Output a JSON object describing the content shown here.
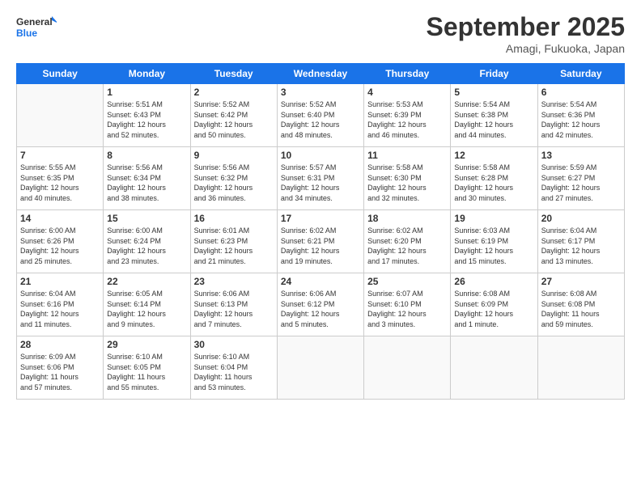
{
  "header": {
    "logo_line1": "General",
    "logo_line2": "Blue",
    "month": "September 2025",
    "location": "Amagi, Fukuoka, Japan"
  },
  "days_of_week": [
    "Sunday",
    "Monday",
    "Tuesday",
    "Wednesday",
    "Thursday",
    "Friday",
    "Saturday"
  ],
  "weeks": [
    [
      {
        "day": "",
        "text": ""
      },
      {
        "day": "1",
        "text": "Sunrise: 5:51 AM\nSunset: 6:43 PM\nDaylight: 12 hours\nand 52 minutes."
      },
      {
        "day": "2",
        "text": "Sunrise: 5:52 AM\nSunset: 6:42 PM\nDaylight: 12 hours\nand 50 minutes."
      },
      {
        "day": "3",
        "text": "Sunrise: 5:52 AM\nSunset: 6:40 PM\nDaylight: 12 hours\nand 48 minutes."
      },
      {
        "day": "4",
        "text": "Sunrise: 5:53 AM\nSunset: 6:39 PM\nDaylight: 12 hours\nand 46 minutes."
      },
      {
        "day": "5",
        "text": "Sunrise: 5:54 AM\nSunset: 6:38 PM\nDaylight: 12 hours\nand 44 minutes."
      },
      {
        "day": "6",
        "text": "Sunrise: 5:54 AM\nSunset: 6:36 PM\nDaylight: 12 hours\nand 42 minutes."
      }
    ],
    [
      {
        "day": "7",
        "text": "Sunrise: 5:55 AM\nSunset: 6:35 PM\nDaylight: 12 hours\nand 40 minutes."
      },
      {
        "day": "8",
        "text": "Sunrise: 5:56 AM\nSunset: 6:34 PM\nDaylight: 12 hours\nand 38 minutes."
      },
      {
        "day": "9",
        "text": "Sunrise: 5:56 AM\nSunset: 6:32 PM\nDaylight: 12 hours\nand 36 minutes."
      },
      {
        "day": "10",
        "text": "Sunrise: 5:57 AM\nSunset: 6:31 PM\nDaylight: 12 hours\nand 34 minutes."
      },
      {
        "day": "11",
        "text": "Sunrise: 5:58 AM\nSunset: 6:30 PM\nDaylight: 12 hours\nand 32 minutes."
      },
      {
        "day": "12",
        "text": "Sunrise: 5:58 AM\nSunset: 6:28 PM\nDaylight: 12 hours\nand 30 minutes."
      },
      {
        "day": "13",
        "text": "Sunrise: 5:59 AM\nSunset: 6:27 PM\nDaylight: 12 hours\nand 27 minutes."
      }
    ],
    [
      {
        "day": "14",
        "text": "Sunrise: 6:00 AM\nSunset: 6:26 PM\nDaylight: 12 hours\nand 25 minutes."
      },
      {
        "day": "15",
        "text": "Sunrise: 6:00 AM\nSunset: 6:24 PM\nDaylight: 12 hours\nand 23 minutes."
      },
      {
        "day": "16",
        "text": "Sunrise: 6:01 AM\nSunset: 6:23 PM\nDaylight: 12 hours\nand 21 minutes."
      },
      {
        "day": "17",
        "text": "Sunrise: 6:02 AM\nSunset: 6:21 PM\nDaylight: 12 hours\nand 19 minutes."
      },
      {
        "day": "18",
        "text": "Sunrise: 6:02 AM\nSunset: 6:20 PM\nDaylight: 12 hours\nand 17 minutes."
      },
      {
        "day": "19",
        "text": "Sunrise: 6:03 AM\nSunset: 6:19 PM\nDaylight: 12 hours\nand 15 minutes."
      },
      {
        "day": "20",
        "text": "Sunrise: 6:04 AM\nSunset: 6:17 PM\nDaylight: 12 hours\nand 13 minutes."
      }
    ],
    [
      {
        "day": "21",
        "text": "Sunrise: 6:04 AM\nSunset: 6:16 PM\nDaylight: 12 hours\nand 11 minutes."
      },
      {
        "day": "22",
        "text": "Sunrise: 6:05 AM\nSunset: 6:14 PM\nDaylight: 12 hours\nand 9 minutes."
      },
      {
        "day": "23",
        "text": "Sunrise: 6:06 AM\nSunset: 6:13 PM\nDaylight: 12 hours\nand 7 minutes."
      },
      {
        "day": "24",
        "text": "Sunrise: 6:06 AM\nSunset: 6:12 PM\nDaylight: 12 hours\nand 5 minutes."
      },
      {
        "day": "25",
        "text": "Sunrise: 6:07 AM\nSunset: 6:10 PM\nDaylight: 12 hours\nand 3 minutes."
      },
      {
        "day": "26",
        "text": "Sunrise: 6:08 AM\nSunset: 6:09 PM\nDaylight: 12 hours\nand 1 minute."
      },
      {
        "day": "27",
        "text": "Sunrise: 6:08 AM\nSunset: 6:08 PM\nDaylight: 11 hours\nand 59 minutes."
      }
    ],
    [
      {
        "day": "28",
        "text": "Sunrise: 6:09 AM\nSunset: 6:06 PM\nDaylight: 11 hours\nand 57 minutes."
      },
      {
        "day": "29",
        "text": "Sunrise: 6:10 AM\nSunset: 6:05 PM\nDaylight: 11 hours\nand 55 minutes."
      },
      {
        "day": "30",
        "text": "Sunrise: 6:10 AM\nSunset: 6:04 PM\nDaylight: 11 hours\nand 53 minutes."
      },
      {
        "day": "",
        "text": ""
      },
      {
        "day": "",
        "text": ""
      },
      {
        "day": "",
        "text": ""
      },
      {
        "day": "",
        "text": ""
      }
    ]
  ]
}
